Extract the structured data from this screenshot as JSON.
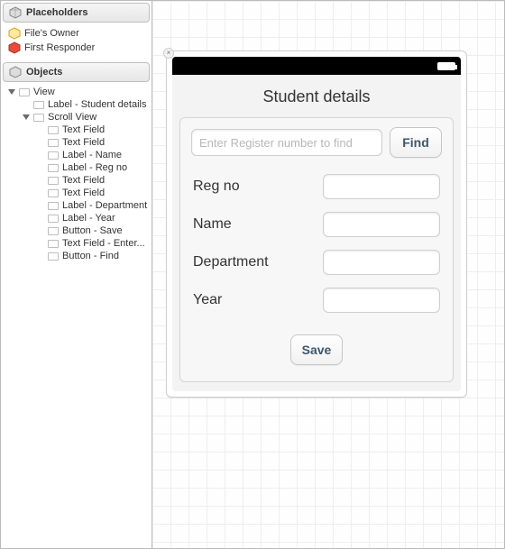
{
  "outline": {
    "placeholders_header": "Placeholders",
    "files_owner": "File's Owner",
    "first_responder": "First Responder",
    "objects_header": "Objects",
    "items": [
      {
        "label": "View",
        "level": 1,
        "disclosure": "open"
      },
      {
        "label": "Label - Student details",
        "level": 2,
        "disclosure": "none"
      },
      {
        "label": "Scroll View",
        "level": 2,
        "disclosure": "open"
      },
      {
        "label": "Text Field",
        "level": 3,
        "disclosure": "none"
      },
      {
        "label": "Text Field",
        "level": 3,
        "disclosure": "none"
      },
      {
        "label": "Label - Name",
        "level": 3,
        "disclosure": "none"
      },
      {
        "label": "Label - Reg no",
        "level": 3,
        "disclosure": "none"
      },
      {
        "label": "Text Field",
        "level": 3,
        "disclosure": "none"
      },
      {
        "label": "Text Field",
        "level": 3,
        "disclosure": "none"
      },
      {
        "label": "Label - Department",
        "level": 3,
        "disclosure": "none"
      },
      {
        "label": "Label - Year",
        "level": 3,
        "disclosure": "none"
      },
      {
        "label": "Button - Save",
        "level": 3,
        "disclosure": "none"
      },
      {
        "label": "Text Field - Enter...",
        "level": 3,
        "disclosure": "none"
      },
      {
        "label": "Button - Find",
        "level": 3,
        "disclosure": "none"
      }
    ]
  },
  "device": {
    "title": "Student details",
    "search_placeholder": "Enter Register number to find",
    "find_label": "Find",
    "fields": {
      "reg_no": "Reg no",
      "name": "Name",
      "department": "Department",
      "year": "Year"
    },
    "save_label": "Save"
  }
}
